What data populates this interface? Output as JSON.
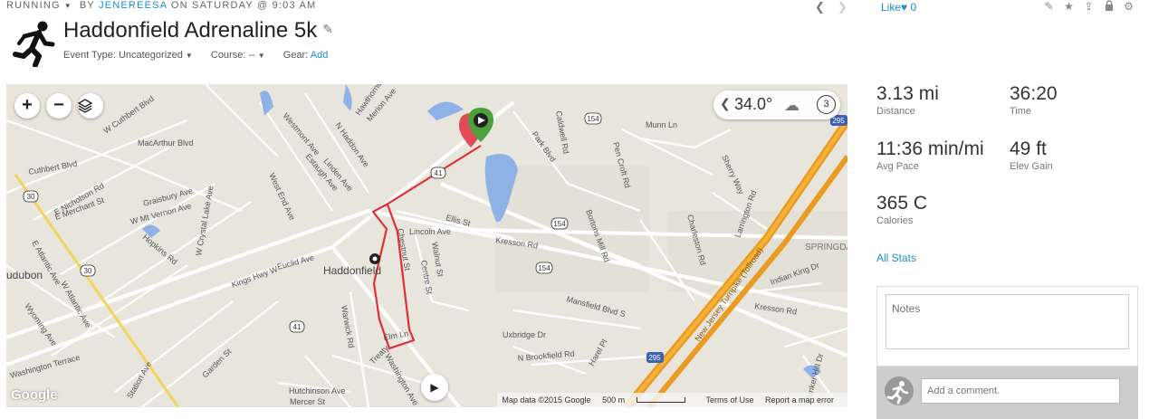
{
  "header": {
    "activity_type": "RUNNING",
    "by": "BY",
    "user": "JENEREESA",
    "date": "ON SATURDAY @ 9:03 AM",
    "like_label": "Like",
    "like_count": "0",
    "title": "Haddonfield Adrenaline 5k",
    "event_type_label": "Event Type: Uncategorized",
    "course_label": "Course: --",
    "gear_label": "Gear:",
    "gear_add": "Add"
  },
  "icons": {
    "activity": "runner-icon",
    "edit": "pencil-icon",
    "prev": "chevron-left-icon",
    "next": "chevron-right-icon",
    "tools": [
      "pencil-icon",
      "star-icon",
      "share-icon",
      "lock-icon",
      "gear-icon"
    ]
  },
  "map": {
    "zoom_in": "+",
    "zoom_out": "−",
    "temperature": "34.0°",
    "lap_count": "3",
    "attribution": "Map data ©2015 Google",
    "scale": "500 m",
    "terms": "Terms of Use",
    "report": "Report a map error",
    "google": "Google",
    "labels": {
      "street": [
        "W Cuthbert Blvd",
        "MacArthur Blvd",
        "Cuthbert Blvd",
        "E Nicholson Rd",
        "E Merchant St",
        "Graisbury Ave",
        "W Mt Vernon Ave",
        "W Crystal Lake Ave",
        "Hopkins Rd",
        "E Atlantic Ave",
        "W Atlantic Ave",
        "Wyoming Ave",
        "Washington Terrace",
        "Station Ave",
        "Garden St",
        "Kings Hwy W",
        "Euclid Ave",
        "West End Ave",
        "Linden Ave",
        "Estaugh Ave",
        "Westmont Ave",
        "N Haddon Ave",
        "Hawthorne Ave",
        "Merion Ave",
        "Ellis St",
        "Lincoln Ave",
        "Walnut St",
        "Centre St",
        "Chestnut St",
        "Warwick Rd",
        "Elm Ln",
        "Washington Ave",
        "Hutchinson Ave",
        "Mercer St",
        "Kresson Rd",
        "Caldwell Rd",
        "Park Blvd",
        "Munn Ln",
        "Pen Croft Rd",
        "Bortons Mill Rd",
        "Charleston Rd",
        "Sherry Way",
        "Larrington Rd",
        "Mansfield Blvd S",
        "Uxbridge Dr",
        "N Brookfield Rd",
        "Harel Pl",
        "Indian King Dr",
        "New Jersey Turnpike (Tollroad)",
        "Bunker Hill Dr",
        "Treaty"
      ],
      "town": [
        "Haddonfield",
        "udubon",
        "SPRINGDAL"
      ],
      "route_shields": [
        "30",
        "30",
        "154",
        "154",
        "154",
        "41",
        "41",
        "295",
        "295"
      ]
    }
  },
  "stats": [
    {
      "value": "3.13 mi",
      "label": "Distance"
    },
    {
      "value": "36:20",
      "label": "Time"
    },
    {
      "value": "11:36 min/mi",
      "label": "Avg Pace"
    },
    {
      "value": "49 ft",
      "label": "Elev Gain"
    },
    {
      "value": "365 C",
      "label": "Calories"
    }
  ],
  "all_stats": "All Stats",
  "notes_placeholder": "Notes",
  "comment_placeholder": "Add a comment."
}
